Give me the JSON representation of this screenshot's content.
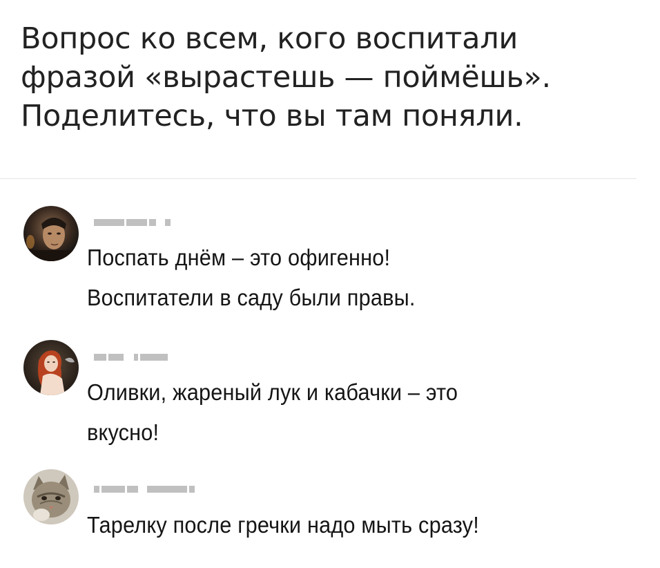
{
  "post": {
    "lines": [
      "Вопрос ко всем, кого воспитали",
      "фразой «вырастешь — поймёшь».",
      "Поделитесь, что вы там поняли."
    ]
  },
  "comments": [
    {
      "avatar_icon": "avatar-man-portrait",
      "lines": [
        "Поспать днём – это офигенно!",
        "Воспитатели в саду были правы."
      ]
    },
    {
      "avatar_icon": "avatar-redhead-woman",
      "lines": [
        "Оливки, жареный лук и кабачки – это",
        "вкусно!"
      ]
    },
    {
      "avatar_icon": "avatar-cat",
      "lines": [
        "Тарелку после гречки надо мыть сразу!"
      ]
    }
  ]
}
